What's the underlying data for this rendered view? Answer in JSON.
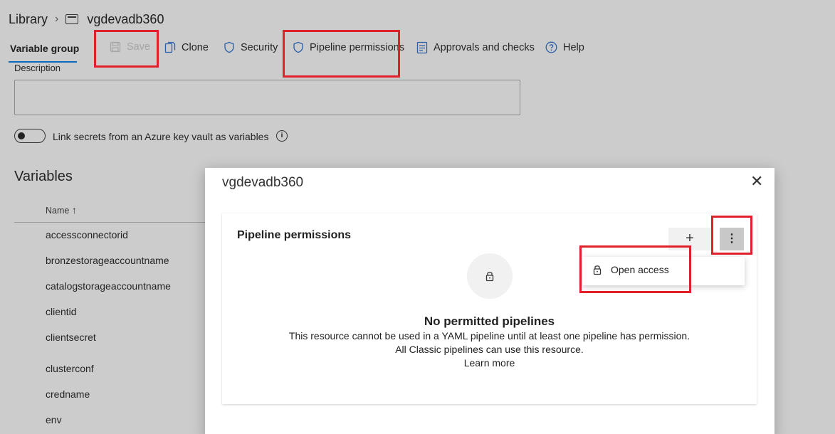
{
  "breadcrumb": {
    "root": "Library",
    "current": "vgdevadb360"
  },
  "toolbar": {
    "active_tab": "Variable group",
    "save": "Save",
    "clone": "Clone",
    "security": "Security",
    "pipeline_permissions": "Pipeline permissions",
    "approvals": "Approvals and checks",
    "help": "Help"
  },
  "form": {
    "description_label": "Description",
    "description_value": "",
    "keyvault_toggle_label": "Link secrets from an Azure key vault as variables",
    "keyvault_toggle_on": false,
    "info_glyph": "i"
  },
  "variables": {
    "heading": "Variables",
    "name_column": "Name",
    "sort_glyph": "↑",
    "rows": [
      "accessconnectorid",
      "bronzestorageaccountname",
      "catalogstorageaccountname",
      "clientid",
      "clientsecret",
      "clusterconf",
      "credname",
      "env"
    ]
  },
  "modal": {
    "title": "vgdevadb360",
    "close_glyph": "✕",
    "section_title": "Pipeline permissions",
    "add_glyph": "+",
    "more_glyph": "⋮",
    "menu_item": "Open access",
    "empty_title": "No permitted pipelines",
    "empty_line1": "This resource cannot be used in a YAML pipeline until at least one pipeline has permission.",
    "empty_line2": "All Classic pipelines can use this resource.",
    "learn_more": "Learn more"
  },
  "colors": {
    "highlight_box": "#e0202a",
    "accent": "#0f6cbd",
    "overlay_bg": "#cccccc"
  }
}
